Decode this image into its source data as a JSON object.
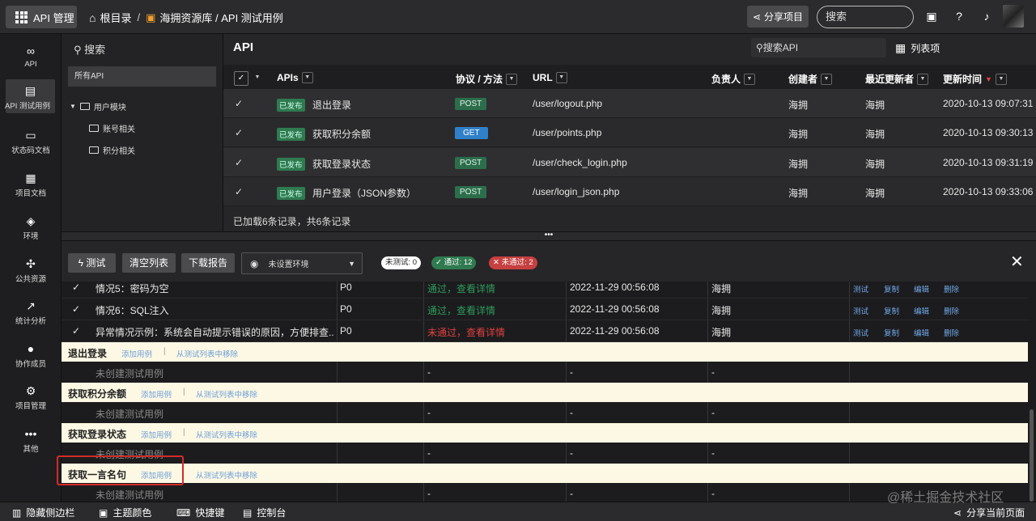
{
  "topbar": {
    "brand_label": "API 管理",
    "breadcrumb_root": "根目录",
    "breadcrumb_sep": "/",
    "breadcrumb_path": "海拥资源库 / API 测试用例",
    "share_label": "分享项目",
    "search_placeholder": "搜索"
  },
  "leftnav": [
    {
      "label": "API",
      "icon": "link-icon"
    },
    {
      "label": "API 测试用例",
      "icon": "clipboard-icon"
    },
    {
      "label": "状态码文档",
      "icon": "doc-icon"
    },
    {
      "label": "项目文档",
      "icon": "book-icon"
    },
    {
      "label": "环境",
      "icon": "cube-icon"
    },
    {
      "label": "公共资源",
      "icon": "puzzle-icon"
    },
    {
      "label": "统计分析",
      "icon": "chart-icon"
    },
    {
      "label": "协作成员",
      "icon": "user-icon"
    },
    {
      "label": "项目管理",
      "icon": "gear-icon"
    },
    {
      "label": "其他",
      "icon": "more-icon"
    }
  ],
  "tree": {
    "search": "搜索",
    "all": "所有API",
    "module": "用户模块",
    "children": [
      "账号相关",
      "积分相关"
    ]
  },
  "api": {
    "title": "API",
    "search": "搜索API",
    "list_view": "列表项",
    "headers": {
      "apis": "APIs",
      "protocol": "协议 / 方法",
      "url": "URL",
      "owner": "负责人",
      "creator": "创建者",
      "updater": "最近更新者",
      "updated": "更新时间"
    },
    "rows": [
      {
        "status": "已发布",
        "name": "退出登录",
        "method": "POST",
        "url": "/user/logout.php",
        "creator": "海拥",
        "updater": "海拥",
        "time": "2020-10-13 09:07:31"
      },
      {
        "status": "已发布",
        "name": "获取积分余额",
        "method": "GET",
        "url": "/user/points.php",
        "creator": "海拥",
        "updater": "海拥",
        "time": "2020-10-13 09:30:13"
      },
      {
        "status": "已发布",
        "name": "获取登录状态",
        "method": "POST",
        "url": "/user/check_login.php",
        "creator": "海拥",
        "updater": "海拥",
        "time": "2020-10-13 09:31:19"
      },
      {
        "status": "已发布",
        "name": "用户登录（JSON参数）",
        "method": "POST",
        "url": "/user/login_json.php",
        "creator": "海拥",
        "updater": "海拥",
        "time": "2020-10-13 09:33:06"
      }
    ],
    "status_text": "已加载6条记录，共6条记录"
  },
  "testbar": {
    "test": "测试",
    "clear": "清空列表",
    "download": "下载报告",
    "env": "未设置环境",
    "untested": "未测试: 0",
    "passed": "通过: 12",
    "failed": "未通过: 2"
  },
  "results": {
    "rows": [
      {
        "name": "情况5：密码为空",
        "priority": "P0",
        "result": "通过，查看详情",
        "time": "2022-11-29 00:56:08",
        "user": "海拥"
      },
      {
        "name": "情况6：SQL注入",
        "priority": "P0",
        "result": "通过，查看详情",
        "time": "2022-11-29 00:56:08",
        "user": "海拥"
      },
      {
        "name": "异常情况示例：系统会自动提示错误的原因，方便排查...",
        "priority": "P0",
        "result": "未通过，查看详情",
        "time": "2022-11-29 00:56:08",
        "user": "海拥"
      }
    ],
    "actions": {
      "test": "测试",
      "copy": "复制",
      "edit": "编辑",
      "delete": "删除"
    },
    "groups": [
      {
        "name": "退出登录"
      },
      {
        "name": "获取积分余额"
      },
      {
        "name": "获取登录状态"
      },
      {
        "name": "获取一言名句"
      }
    ],
    "add_case": "添加用例",
    "group_sep": "|",
    "remove": "从测试列表中移除",
    "empty": "未创建测试用例",
    "dash": "-"
  },
  "bottombar": {
    "hide_sidebar": "隐藏侧边栏",
    "theme": "主题颜色",
    "shortcuts": "快捷键",
    "console": "控制台",
    "share_page": "分享当前页面"
  },
  "watermark": "@稀土掘金技术社区"
}
